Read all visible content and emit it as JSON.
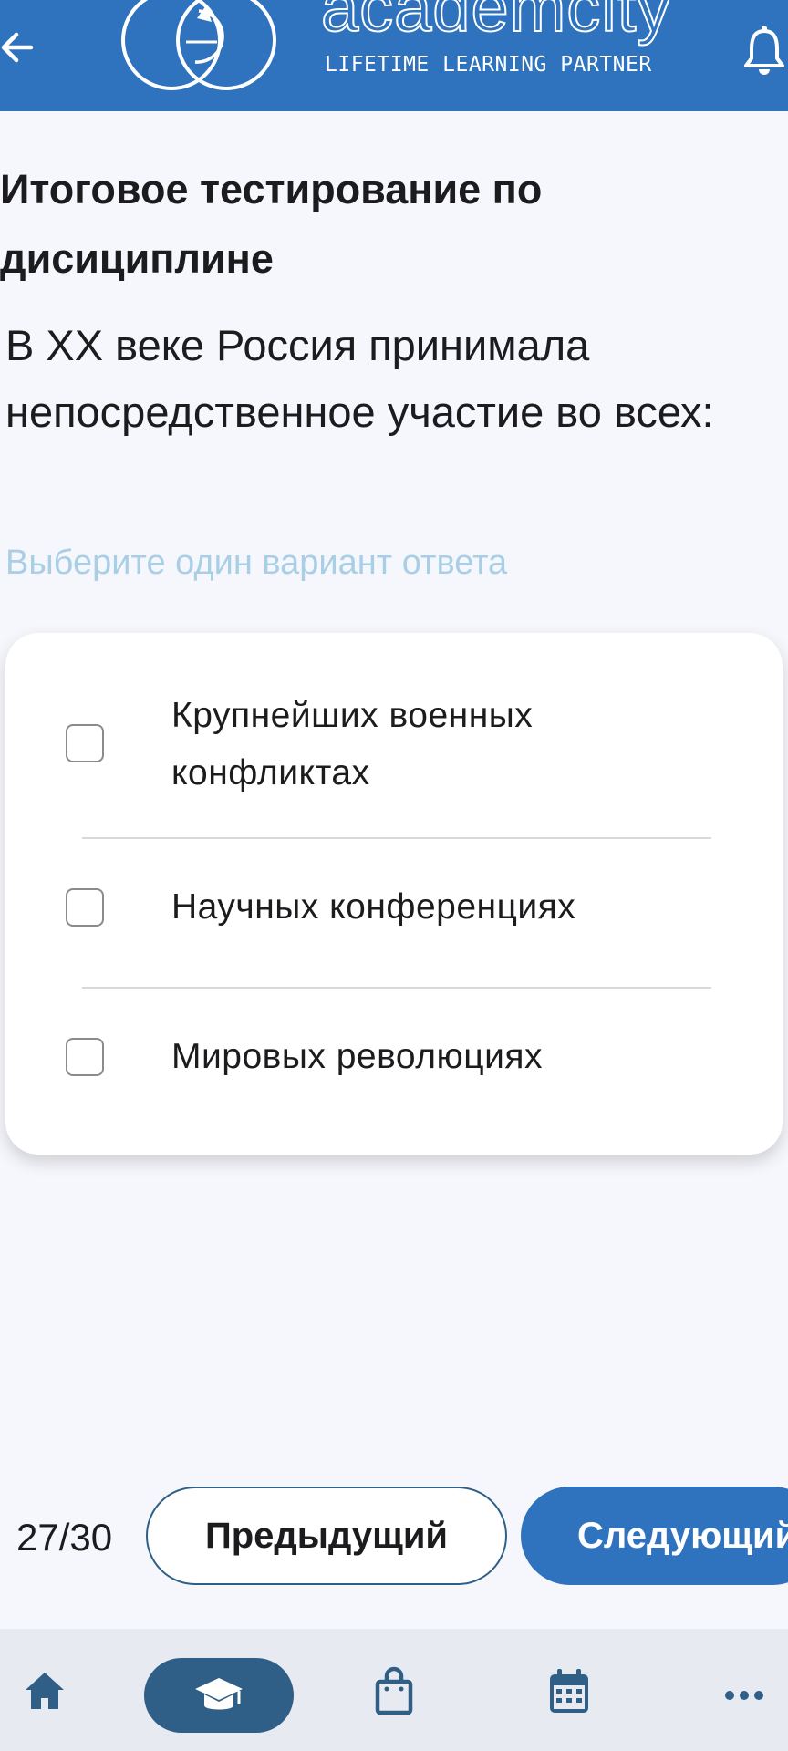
{
  "header": {
    "back_icon": "arrow-left-icon",
    "logo": {
      "name": "academcity",
      "tagline": "LIFETIME LEARNING PARTNER"
    },
    "notifications_icon": "bell-icon",
    "color": "#2f72bd"
  },
  "test": {
    "title": "Итоговое тестирование по дисициплине",
    "question": "В XX веке Россия принимала непосредственное участие во всех:",
    "hint": "Выберите один вариант ответа",
    "options": [
      {
        "label": "Крупнейших военных конфликтах",
        "checked": false
      },
      {
        "label": "Научных конференциях",
        "checked": false
      },
      {
        "label": "Мировых революциях",
        "checked": false
      }
    ]
  },
  "pagination": {
    "counter": "27/30",
    "prev_label": "Предыдущий",
    "next_label": "Следующий"
  },
  "bottom_nav": {
    "items": [
      {
        "icon": "home-icon",
        "active": false
      },
      {
        "icon": "graduation-cap-icon",
        "active": true
      },
      {
        "icon": "shopping-bag-icon",
        "active": false
      },
      {
        "icon": "calendar-icon",
        "active": false
      },
      {
        "icon": "more-icon",
        "active": false
      }
    ],
    "active_color": "#2f5f86"
  }
}
